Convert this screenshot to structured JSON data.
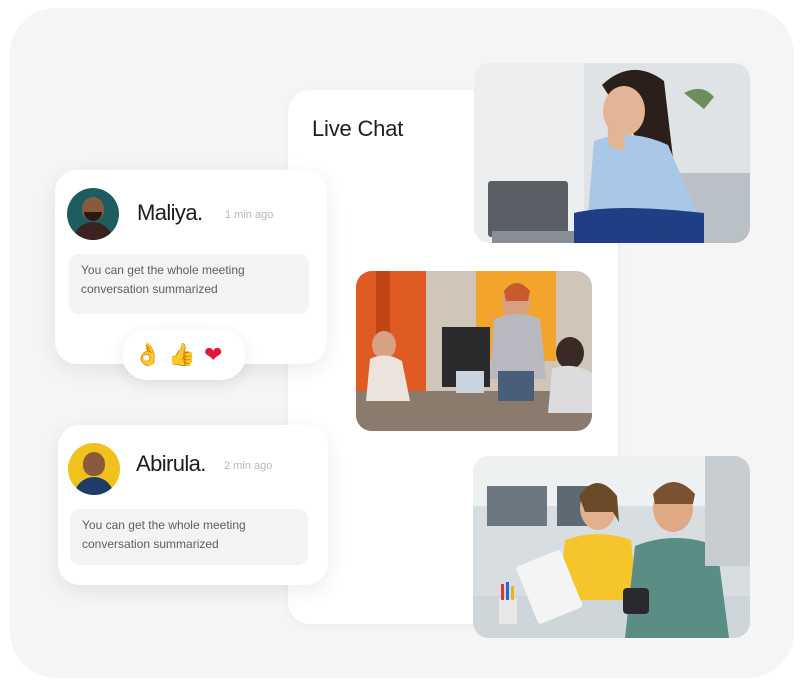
{
  "chat_panel": {
    "title": "Live Chat"
  },
  "messages": [
    {
      "sender": "Maliya.",
      "time": "1 min ago",
      "text": "You can get the whole meeting conversation summarized"
    },
    {
      "sender": "Abirula.",
      "time": "2 min ago",
      "text": "You can get the whole meeting conversation summarized"
    }
  ],
  "reactions": [
    "👌",
    "👍",
    "❤"
  ],
  "colors": {
    "background": "#f5f5f6",
    "card": "#ffffff",
    "bubble": "#f3f3f4",
    "heart": "#e0183a"
  }
}
